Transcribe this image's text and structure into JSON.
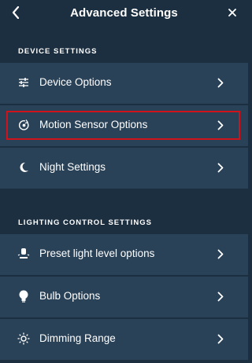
{
  "header": {
    "title": "Advanced Settings",
    "back_icon": "chevron-left-icon",
    "close_icon": "close-icon"
  },
  "sections": [
    {
      "title": "DEVICE SETTINGS",
      "items": [
        {
          "label": "Device Options",
          "icon": "sliders-icon"
        },
        {
          "label": "Motion Sensor Options",
          "icon": "motion-sensor-icon"
        },
        {
          "label": "Night Settings",
          "icon": "moon-icon"
        }
      ]
    },
    {
      "title": "LIGHTING CONTROL SETTINGS",
      "items": [
        {
          "label": "Preset light level options",
          "icon": "light-level-icon"
        },
        {
          "label": "Bulb Options",
          "icon": "bulb-icon"
        },
        {
          "label": "Dimming Range",
          "icon": "brightness-icon"
        }
      ]
    }
  ],
  "colors": {
    "background": "#1c2f40",
    "row": "#2a4258",
    "highlight": "#d0121b"
  }
}
